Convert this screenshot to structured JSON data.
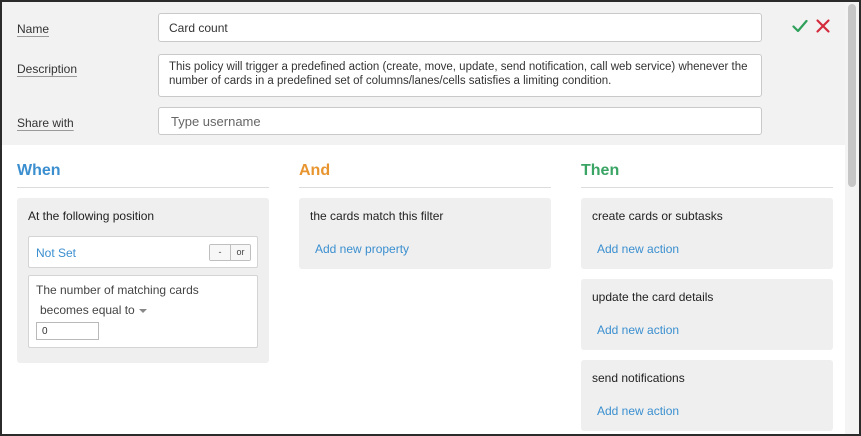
{
  "form": {
    "name_label": "Name",
    "name_value": "Card count",
    "description_label": "Description",
    "description_value": "This policy will trigger a predefined action (create, move, update, send notification, call web service) whenever the number of cards in a predefined set of columns/lanes/cells satisfies a limiting condition.",
    "share_label": "Share with",
    "share_placeholder": "Type username"
  },
  "actions": {
    "confirm_icon": "check-icon",
    "cancel_icon": "close-icon"
  },
  "colors": {
    "when": "#3b8fcf",
    "and": "#e8952f",
    "then": "#3aa464",
    "confirm": "#2fa05a",
    "cancel": "#d42a3c",
    "link": "#3a8fd0"
  },
  "when": {
    "heading": "When",
    "card_title": "At the following position",
    "position_value": "Not Set",
    "toggle_minus": "-",
    "toggle_or": "or",
    "condition_text": "The number of matching cards",
    "condition_operator": "becomes equal to",
    "condition_value": "0"
  },
  "and": {
    "heading": "And",
    "card_title": "the cards match this filter",
    "link": "Add new property"
  },
  "then": {
    "heading": "Then",
    "cards": [
      {
        "title": "create cards or subtasks",
        "link": "Add new action"
      },
      {
        "title": "update the card details",
        "link": "Add new action"
      },
      {
        "title": "send notifications",
        "link": "Add new action"
      }
    ]
  }
}
